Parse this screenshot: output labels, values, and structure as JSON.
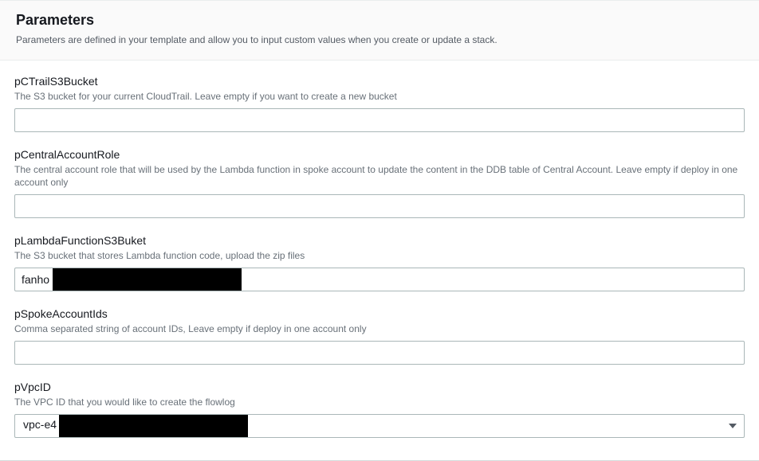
{
  "header": {
    "title": "Parameters",
    "description": "Parameters are defined in your template and allow you to input custom values when you create or update a stack."
  },
  "params": {
    "pCTrailS3Bucket": {
      "label": "pCTrailS3Bucket",
      "description": "The S3 bucket for your current CloudTrail. Leave empty if you want to create a new bucket",
      "value": ""
    },
    "pCentralAccountRole": {
      "label": "pCentralAccountRole",
      "description": "The central account role that will be used by the Lambda function in spoke account to update the content in the DDB table of Central Account. Leave empty if deploy in one account only",
      "value": ""
    },
    "pLambdaFunctionS3Buket": {
      "label": "pLambdaFunctionS3Buket",
      "description": "The S3 bucket that stores Lambda function code, upload the zip files",
      "value": "fanho"
    },
    "pSpokeAccountIds": {
      "label": "pSpokeAccountIds",
      "description": "Comma separated string of account IDs, Leave empty if deploy in one account only",
      "value": ""
    },
    "pVpcID": {
      "label": "pVpcID",
      "description": "The VPC ID that you would like to create the flowlog",
      "value": "vpc-e4"
    }
  }
}
